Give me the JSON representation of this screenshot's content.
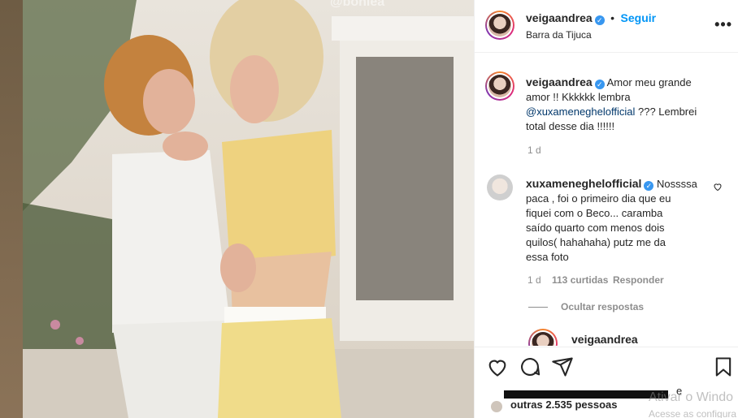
{
  "media": {
    "watermark": "@bohlea"
  },
  "post_header": {
    "username": "veigaandrea",
    "follow_label": "Seguir",
    "location": "Barra da Tijuca",
    "more_label": "•••"
  },
  "caption": {
    "username": "veigaandrea",
    "text_line1": "Amor meu grande",
    "text_line2": "amor !! Kkkkkk lembra",
    "mention": "@xuxameneghelofficial",
    "text_line3_rest": " ??? Lembrei",
    "text_line4": "total desse dia !!!!!!",
    "time": "1 d"
  },
  "comment": {
    "username": "xuxameneghelofficial",
    "first_line_rest": "Nossssa",
    "line2": "paca , foi o primeiro dia que eu",
    "line3": "fiquei com o Beco... caramba",
    "line4": "saído quarto com menos dois",
    "line5": "quilos( hahahaha) putz me da",
    "line6": "essa foto",
    "time": "1 d",
    "likes": "113 curtidas",
    "reply_label": "Responder",
    "hide_replies_label": "Ocultar respostas"
  },
  "reply_preview": {
    "username": "veigaandrea"
  },
  "likes_bar": {
    "trailing_char": "e",
    "others_text": "outras 2.535 pessoas"
  },
  "os_watermark": {
    "line1": "Ativar o Windo",
    "line2": "Acesse as configura"
  }
}
